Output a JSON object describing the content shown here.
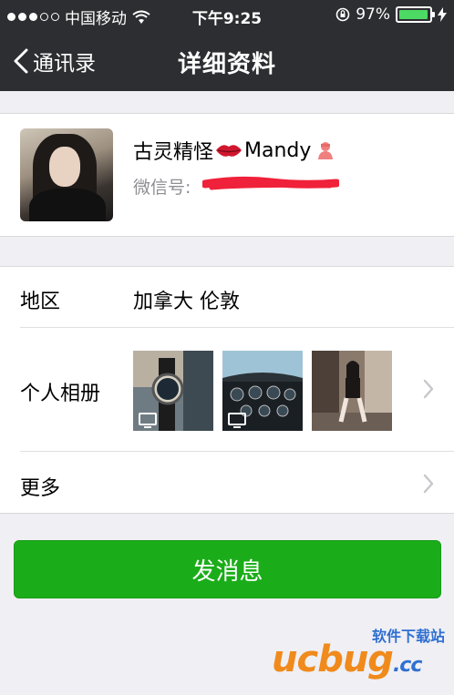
{
  "status_bar": {
    "carrier": "中国移动",
    "time": "下午9:25",
    "battery": "97%",
    "battery_level": 0.97
  },
  "nav": {
    "back_label": "通讯录",
    "title": "详细资料"
  },
  "profile": {
    "name": "古灵精怪",
    "name_suffix": "Mandy",
    "wechat_id_label": "微信号:"
  },
  "details": {
    "region_label": "地区",
    "region_value": "加拿大 伦敦",
    "album_label": "个人相册",
    "more_label": "更多"
  },
  "actions": {
    "send_message": "发消息"
  },
  "watermark": {
    "top": "软件下载站",
    "logo": "ucbug",
    "suffix": ".cc"
  },
  "colors": {
    "nav_bg": "#2d2e32",
    "primary_button": "#1aad19",
    "battery_fill": "#4cd964"
  }
}
